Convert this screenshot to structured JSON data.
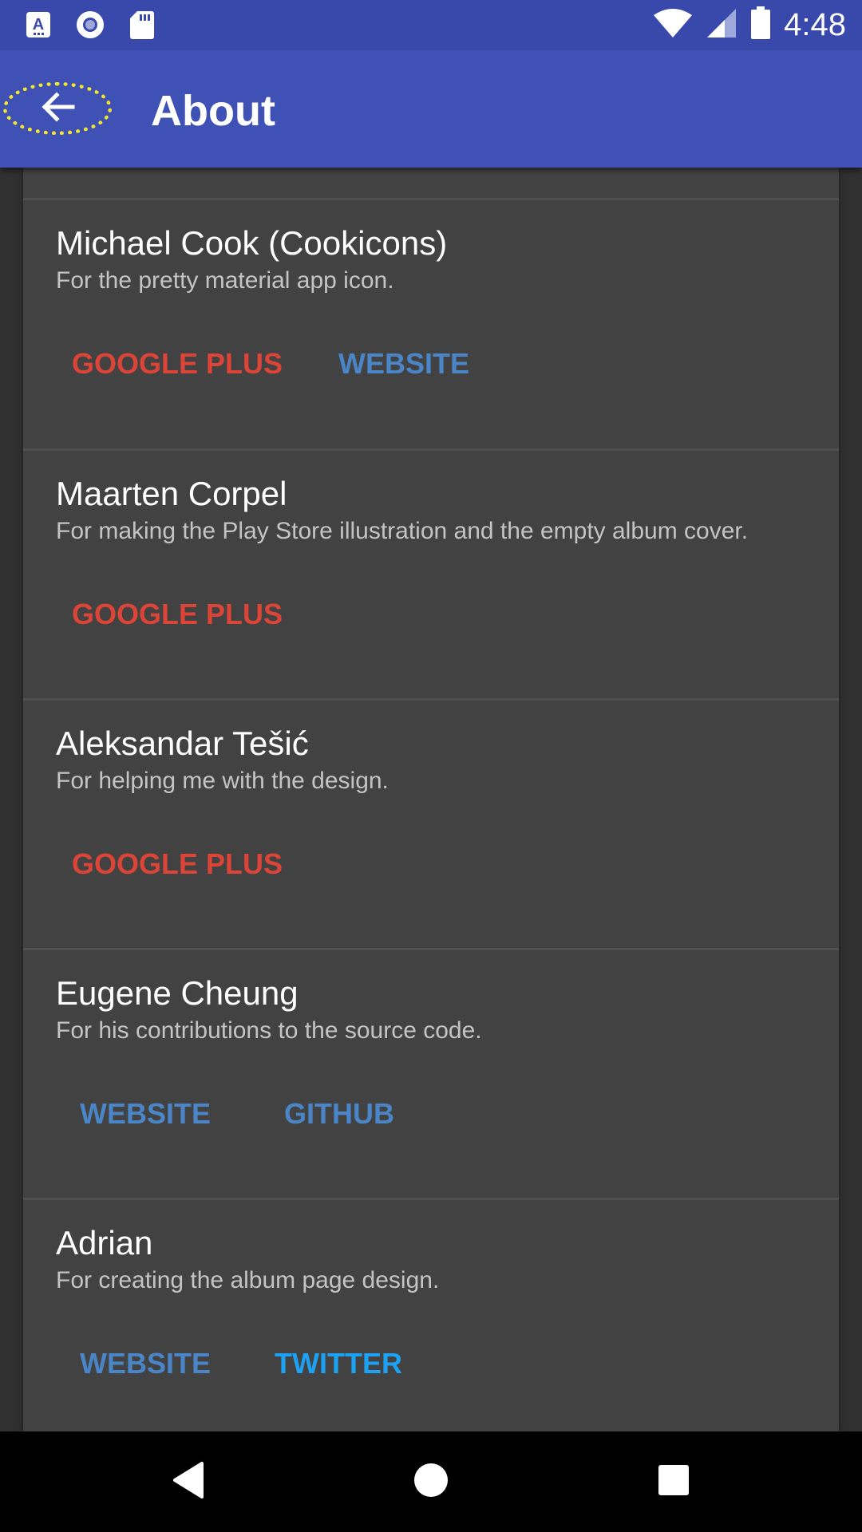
{
  "status_bar": {
    "time": "4:48",
    "icons": [
      "a-notification-icon",
      "radio-icon",
      "sd-card-icon",
      "wifi-icon",
      "cell-signal-icon",
      "battery-icon"
    ]
  },
  "app_bar": {
    "title": "About",
    "back_icon": "arrow-back-icon",
    "highlight_color": "#f5e62a",
    "color": "#3f51b5"
  },
  "credits": [
    {
      "name": "Michael Cook (Cookicons)",
      "description": "For the pretty material app icon.",
      "actions": [
        {
          "label": "GOOGLE PLUS",
          "color": "#db4437"
        },
        {
          "label": "WEBSITE",
          "color": "#4a85c8"
        }
      ]
    },
    {
      "name": "Maarten Corpel",
      "description": "For making the Play Store illustration and the empty album cover.",
      "actions": [
        {
          "label": "GOOGLE PLUS",
          "color": "#db4437"
        }
      ]
    },
    {
      "name": "Aleksandar Tešić",
      "description": "For helping me with the design.",
      "actions": [
        {
          "label": "GOOGLE PLUS",
          "color": "#db4437"
        }
      ]
    },
    {
      "name": "Eugene Cheung",
      "description": "For his contributions to the source code.",
      "actions": [
        {
          "label": "WEBSITE",
          "color": "#4a85c8"
        },
        {
          "label": "GITHUB",
          "color": "#4a85c8"
        }
      ]
    },
    {
      "name": "Adrian",
      "description": "For creating the album page design.",
      "actions": [
        {
          "label": "WEBSITE",
          "color": "#4a85c8"
        },
        {
          "label": "TWITTER",
          "color": "#1da1f2"
        }
      ]
    }
  ],
  "nav_bar": {
    "icons": [
      "back-triangle-icon",
      "home-circle-icon",
      "recents-square-icon"
    ]
  }
}
